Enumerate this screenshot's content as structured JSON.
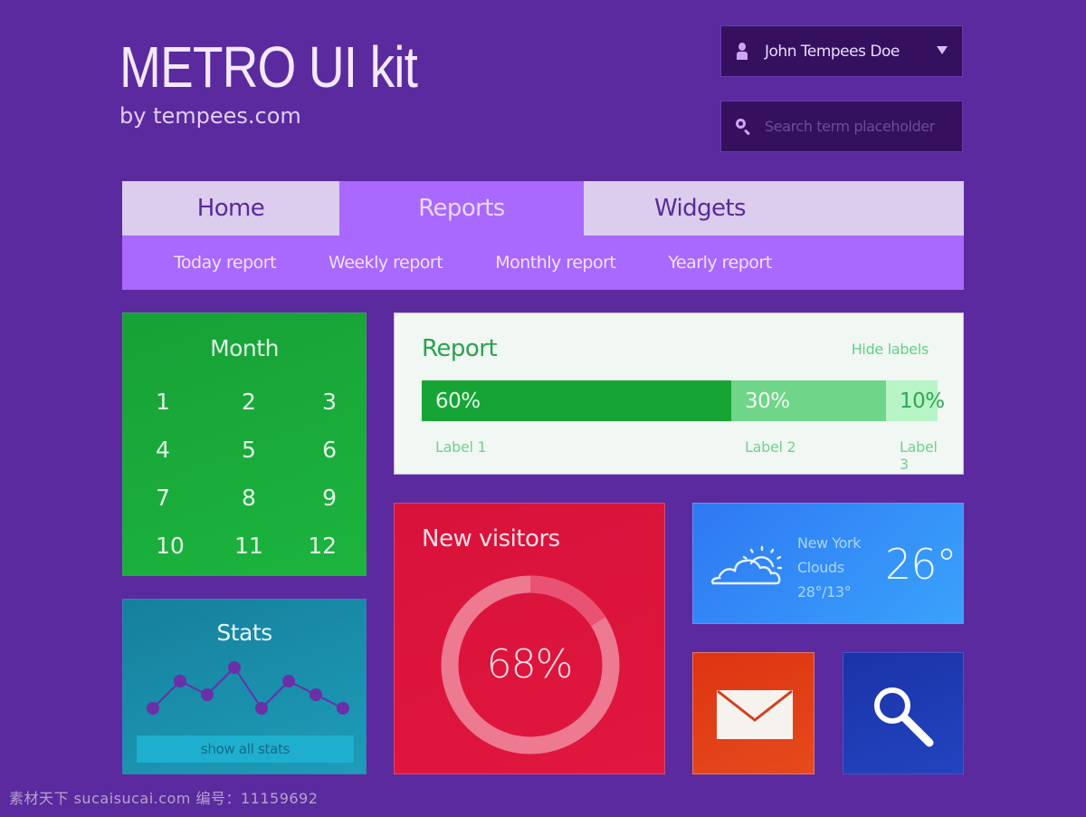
{
  "brand": {
    "title": "METRO UI kit",
    "subtitle": "by tempees.com"
  },
  "user_menu": {
    "icon": "user-icon",
    "name": "John Tempees Doe",
    "caret_icon": "caret-down-icon"
  },
  "search": {
    "icon": "search-icon",
    "value": "",
    "placeholder": "Search term placeholder"
  },
  "nav": {
    "tabs": [
      {
        "label": "Home",
        "active": false
      },
      {
        "label": "Reports",
        "active": true
      },
      {
        "label": "Widgets",
        "active": false
      }
    ],
    "subtabs": [
      {
        "label": "Today report"
      },
      {
        "label": "Weekly report"
      },
      {
        "label": "Monthly report"
      },
      {
        "label": "Yearly report"
      }
    ]
  },
  "month": {
    "title": "Month",
    "days": [
      "1",
      "2",
      "3",
      "4",
      "5",
      "6",
      "7",
      "8",
      "9",
      "10",
      "11",
      "12"
    ]
  },
  "stats": {
    "title": "Stats",
    "points": [
      2,
      4,
      3,
      5,
      2,
      4,
      3,
      2
    ],
    "button_label": "show all stats"
  },
  "report": {
    "title": "Report",
    "hide_labels": "Hide labels",
    "segments": [
      {
        "value": 60,
        "display": "60%",
        "label": "Label 1",
        "color": "#16a535",
        "text_color": "#e5f8ea"
      },
      {
        "value": 30,
        "display": "30%",
        "label": "Label 2",
        "color": "#6fd588",
        "text_color": "#effbf2"
      },
      {
        "value": 10,
        "display": "10%",
        "label": "Label 3",
        "color": "#b7f5c6",
        "text_color": "#2fa752"
      }
    ]
  },
  "visitors": {
    "title": "New visitors",
    "percent": 68,
    "display": "68%"
  },
  "weather": {
    "icon": "partly-cloudy-icon",
    "city": "New York",
    "condition": "Clouds",
    "range": "28°/13°",
    "temperature": "26°"
  },
  "tiles": {
    "mail_icon": "mail-icon",
    "search_icon": "search-icon"
  },
  "watermark": "素材天下 sucaisucai.com  编号：11159692",
  "colors": {
    "background": "#5b2a9e",
    "accent": "#a968fe",
    "green": "#17a136",
    "teal": "#1a8eab",
    "red": "#dc153c",
    "blue": "#3390f8",
    "orange": "#e03e16",
    "navy": "#1f3db5"
  }
}
